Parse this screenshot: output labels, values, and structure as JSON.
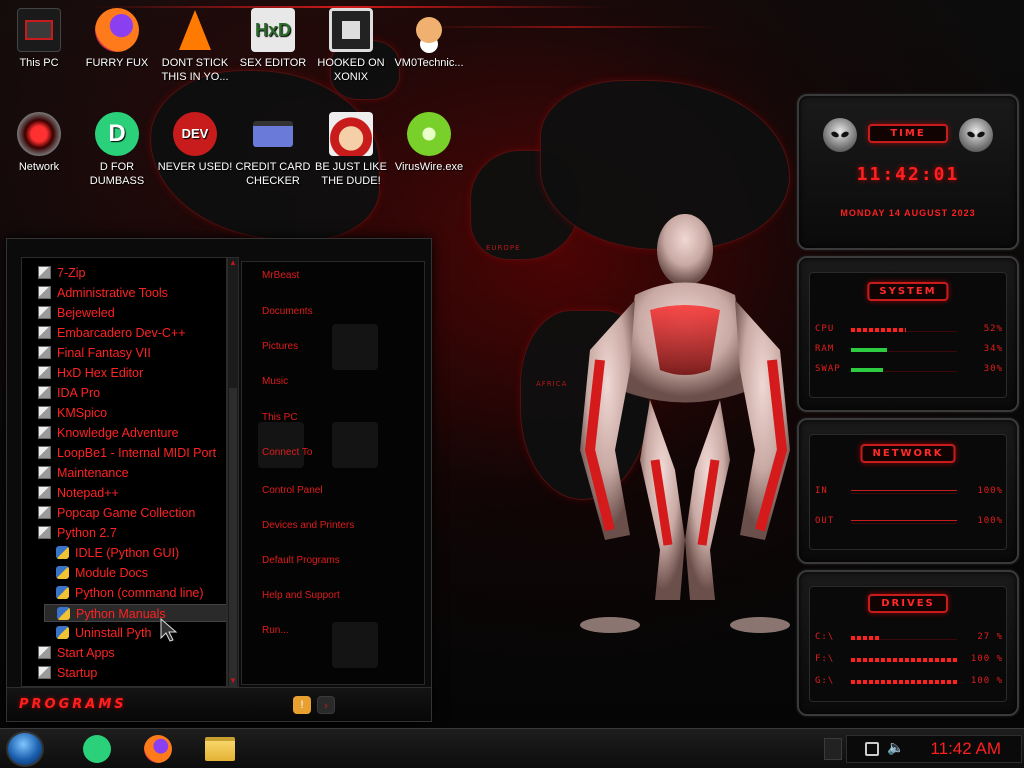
{
  "desktop_icons": [
    {
      "label": "This PC",
      "icon": "computer-icon"
    },
    {
      "label": "FURRY FUX",
      "icon": "firefox-icon"
    },
    {
      "label": "DONT STICK THIS IN YO...",
      "icon": "vlc-cone-icon"
    },
    {
      "label": "SEX EDITOR",
      "icon": "hxd-icon"
    },
    {
      "label": "HOOKED ON XONIX",
      "icon": "xonix-icon"
    },
    {
      "label": "VM0Technic...",
      "icon": "doctor-icon"
    },
    {
      "label": "Network",
      "icon": "network-icon"
    },
    {
      "label": "D FOR DUMBASS",
      "icon": "d-icon"
    },
    {
      "label": "NEVER USED!",
      "icon": "devcpp-icon"
    },
    {
      "label": "CREDIT CARD CHECKER",
      "icon": "credit-card-icon"
    },
    {
      "label": "BE JUST LIKE THE DUDE!",
      "icon": "santa-icon"
    },
    {
      "label": "VirusWire.exe",
      "icon": "lime-icon"
    }
  ],
  "map_labels": {
    "europe": "EUROPE",
    "africa": "AFRICA"
  },
  "gadgets": {
    "time": {
      "title": "TIME",
      "clock": "11:42:01",
      "date": "MONDAY 14 AUGUST 2023"
    },
    "system": {
      "title": "SYSTEM",
      "rows": [
        {
          "label": "CPU",
          "value": "52%",
          "level": 0.52
        },
        {
          "label": "RAM",
          "value": "34%",
          "level": 0.34
        },
        {
          "label": "SWAP",
          "value": "30%",
          "level": 0.3
        }
      ]
    },
    "network": {
      "title": "NETWORK",
      "rows": [
        {
          "label": "IN",
          "value": "100%",
          "level": 1.0
        },
        {
          "label": "OUT",
          "value": "100%",
          "level": 1.0
        }
      ]
    },
    "drives": {
      "title": "DRIVES",
      "rows": [
        {
          "label": "C:\\",
          "value": "27 %",
          "level": 0.27
        },
        {
          "label": "F:\\",
          "value": "100 %",
          "level": 1.0
        },
        {
          "label": "G:\\",
          "value": "100 %",
          "level": 1.0
        }
      ]
    }
  },
  "start_menu": {
    "programs": [
      {
        "label": "7-Zip",
        "icon": "folder-icon",
        "sub": false
      },
      {
        "label": "Administrative Tools",
        "icon": "folder-icon",
        "sub": false
      },
      {
        "label": "Bejeweled",
        "icon": "folder-icon",
        "sub": false
      },
      {
        "label": "Embarcadero Dev-C++",
        "icon": "folder-icon",
        "sub": false
      },
      {
        "label": "Final Fantasy VII",
        "icon": "folder-icon",
        "sub": false
      },
      {
        "label": "HxD Hex Editor",
        "icon": "folder-icon",
        "sub": false
      },
      {
        "label": "IDA Pro",
        "icon": "folder-icon",
        "sub": false
      },
      {
        "label": "KMSpico",
        "icon": "folder-icon",
        "sub": false
      },
      {
        "label": "Knowledge Adventure",
        "icon": "folder-icon",
        "sub": false
      },
      {
        "label": "LoopBe1 - Internal MIDI Port",
        "icon": "folder-icon",
        "sub": false
      },
      {
        "label": "Maintenance",
        "icon": "folder-icon",
        "sub": false
      },
      {
        "label": "Notepad++",
        "icon": "folder-icon",
        "sub": false
      },
      {
        "label": "Popcap Game Collection",
        "icon": "folder-icon",
        "sub": false
      },
      {
        "label": "Python 2.7",
        "icon": "folder-icon",
        "sub": false
      },
      {
        "label": "IDLE (Python GUI)",
        "icon": "python-icon",
        "sub": true
      },
      {
        "label": "Module Docs",
        "icon": "python-icon",
        "sub": true
      },
      {
        "label": "Python (command line)",
        "icon": "python-icon",
        "sub": true
      },
      {
        "label": "Python Manuals",
        "icon": "python-icon",
        "sub": true,
        "selected": true
      },
      {
        "label": "Uninstall Pyth",
        "icon": "python-icon",
        "sub": true
      },
      {
        "label": "Start Apps",
        "icon": "folder-icon",
        "sub": false
      },
      {
        "label": "Startup",
        "icon": "folder-icon",
        "sub": false
      }
    ],
    "places": [
      "MrBeast",
      "Documents",
      "Pictures",
      "Music",
      "This PC",
      "Connect To",
      "Control Panel",
      "Devices and Printers",
      "Default Programs",
      "Help and Support",
      "Run..."
    ],
    "footer_label": "PROGRAMS"
  },
  "taskbar": {
    "pinned": [
      {
        "name": "d-app",
        "icon": "d-icon"
      },
      {
        "name": "firefox",
        "icon": "firefox-icon"
      },
      {
        "name": "file-explorer",
        "icon": "folder-icon"
      }
    ],
    "clock": "11:42 AM"
  },
  "colors": {
    "accent": "#ff1f1f",
    "background": "#050505"
  }
}
